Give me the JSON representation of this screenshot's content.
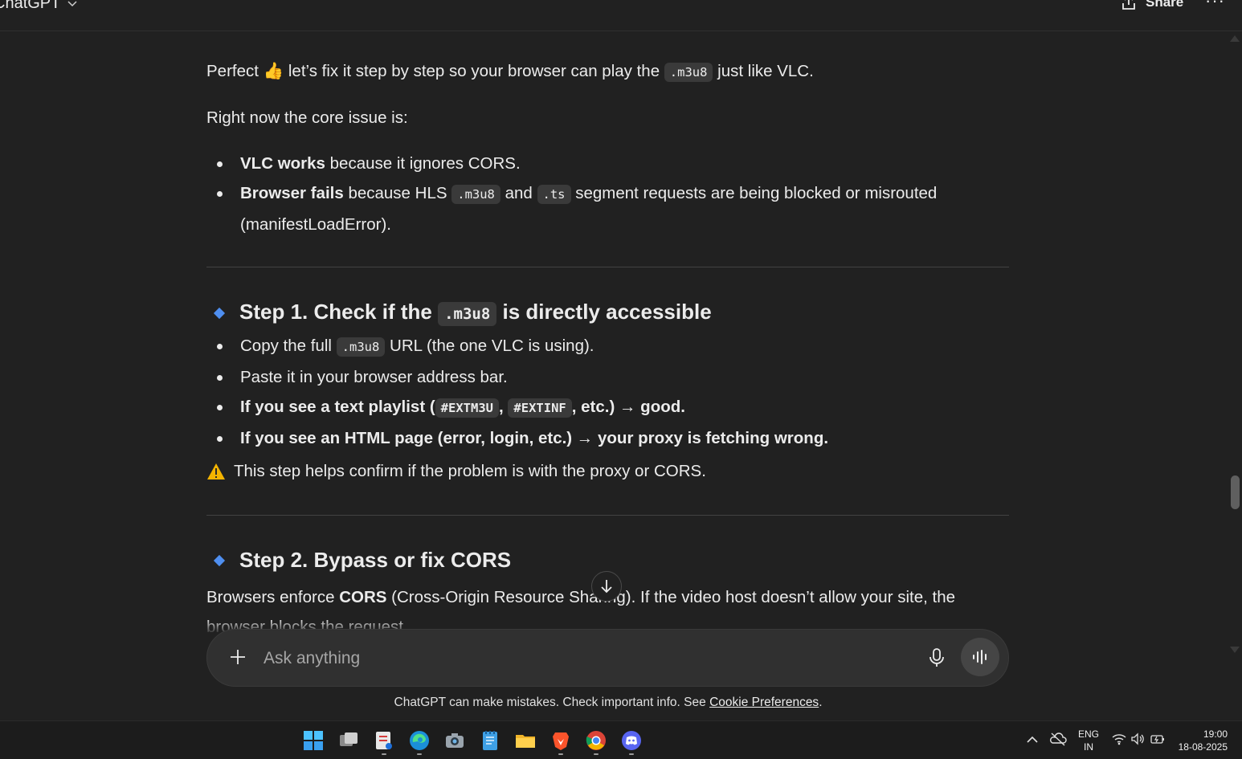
{
  "header": {
    "app_title": "ChatGPT",
    "share_label": "Share",
    "more_label": "···"
  },
  "message": {
    "intro_a": "Perfect ",
    "intro_emoji": "👍",
    "intro_b": " let’s fix it step by step so your browser can play the ",
    "intro_code": ".m3u8",
    "intro_c": " just like VLC.",
    "core_issue": "Right now the core issue is:",
    "bullets1": {
      "b1_bold": "VLC works",
      "b1_text": " because it ignores CORS.",
      "b2_bold": "Browser fails",
      "b2_text_a": " because HLS ",
      "b2_code1": ".m3u8",
      "b2_text_b": " and ",
      "b2_code2": ".ts",
      "b2_text_c": " segment requests are being blocked or misrouted (manifestLoadError)."
    },
    "step1": {
      "heading_a": "Step 1. Check if the ",
      "heading_code": ".m3u8",
      "heading_b": " is directly accessible",
      "i1_a": "Copy the full ",
      "i1_code": ".m3u8",
      "i1_b": " URL (the one VLC is using).",
      "i2": "Paste it in your browser address bar.",
      "i3_a": "If you see a text playlist (",
      "i3_code1": "#EXTM3U",
      "i3_sep": ", ",
      "i3_code2": "#EXTINF",
      "i3_b": ", etc.) → good.",
      "i4": "If you see an HTML page (error, login, etc.) → your proxy is fetching wrong.",
      "warning": "This step helps confirm if the problem is with the proxy or CORS."
    },
    "step2": {
      "heading": "Step 2. Bypass or fix CORS",
      "p_a": "Browsers enforce ",
      "p_bold": "CORS",
      "p_b": " (Cross-Origin Resource Sharing). If the video host doesn’t allow your site, the browser blocks the request."
    }
  },
  "composer": {
    "placeholder": "Ask anything"
  },
  "footer": {
    "disclaimer": "ChatGPT can make mistakes. Check important info. See ",
    "link": "Cookie Preferences",
    "end": "."
  },
  "taskbar": {
    "lang_1": "ENG",
    "lang_2": "IN",
    "time": "19:00",
    "date": "18-08-2025"
  },
  "colors": {
    "background": "#212121",
    "accent_diamond": "#4f8ff0",
    "warning": "#f4b400"
  }
}
